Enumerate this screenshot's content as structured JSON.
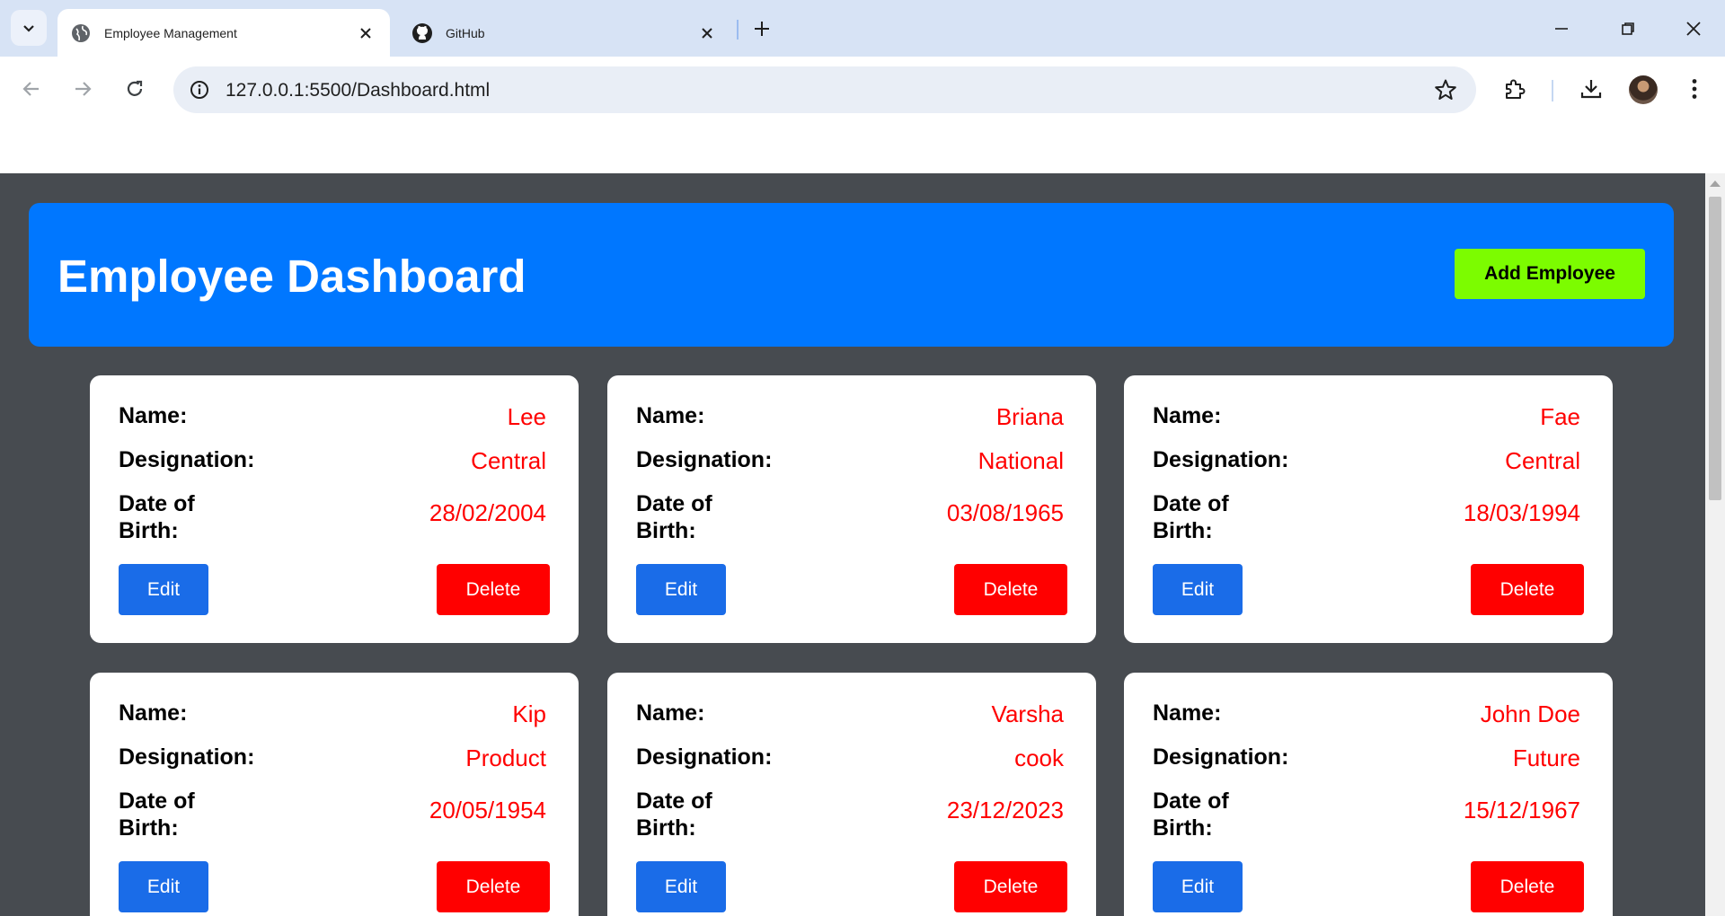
{
  "browser": {
    "tabs": [
      {
        "title": "Employee Management",
        "icon": "globe-icon",
        "active": true
      },
      {
        "title": "GitHub",
        "icon": "github-icon",
        "active": false
      }
    ],
    "url": "127.0.0.1:5500/Dashboard.html"
  },
  "header": {
    "title": "Employee Dashboard",
    "add_button_label": "Add Employee"
  },
  "labels": {
    "name": "Name:",
    "designation": "Designation:",
    "dob_line1": "Date of",
    "dob_line2": "Birth:",
    "edit": "Edit",
    "delete": "Delete"
  },
  "employees": [
    {
      "name": "Lee",
      "designation": "Central",
      "dob": "28/02/2004"
    },
    {
      "name": "Briana",
      "designation": "National",
      "dob": "03/08/1965"
    },
    {
      "name": "Fae",
      "designation": "Central",
      "dob": "18/03/1994"
    },
    {
      "name": "Kip",
      "designation": "Product",
      "dob": "20/05/1954"
    },
    {
      "name": "Varsha",
      "designation": "cook",
      "dob": "23/12/2023"
    },
    {
      "name": "John Doe",
      "designation": "Future",
      "dob": "15/12/1967"
    }
  ],
  "colors": {
    "header_bg": "#0077ff",
    "add_button_bg": "#7cfc00",
    "edit_bg": "#1a6ce8",
    "delete_bg": "#ff0000",
    "value_text": "#ff0000",
    "page_bg": "#474b50"
  }
}
